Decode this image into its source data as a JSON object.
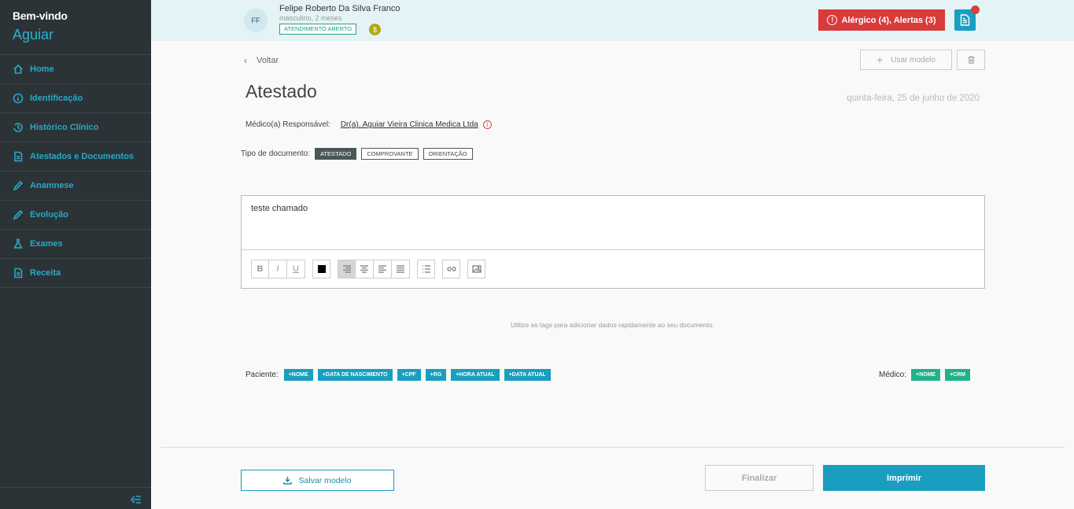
{
  "sidebar": {
    "welcome": "Bem-vindo",
    "user": "Aguiar",
    "items": [
      {
        "label": "Home",
        "icon": "home-icon"
      },
      {
        "label": "Identificação",
        "icon": "info-icon"
      },
      {
        "label": "Histórico Clínico",
        "icon": "history-icon"
      },
      {
        "label": "Atestados e Documentos",
        "icon": "document-icon"
      },
      {
        "label": "Anamnese",
        "icon": "pencil-icon"
      },
      {
        "label": "Evolução",
        "icon": "pencil-icon"
      },
      {
        "label": "Exames",
        "icon": "flask-icon"
      },
      {
        "label": "Receita",
        "icon": "document-icon"
      }
    ]
  },
  "patient": {
    "initials": "FF",
    "name": "Felipe Roberto Da Silva Franco",
    "info": "masculino, 2 meses",
    "status": "ATENDIMENTO ABERTO",
    "badge": "$"
  },
  "header": {
    "alert_icon": "!",
    "alert_label": "Alérgico (4),  Alertas (3)"
  },
  "page": {
    "back": "Voltar",
    "use_model": "Usar modelo",
    "title": "Atestado",
    "date": "quinta-feira, 25 de junho de 2020",
    "resp_label": "Médico(a) Responsável:",
    "resp_value": "Dr(a). Aguiar Vieira Clinica Medica Ltda",
    "resp_info": "i",
    "doc_type_label": "Tipo de documento:",
    "doc_types": [
      "ATESTADO",
      "COMPROVANTE",
      "ORIENTAÇÃO"
    ],
    "editor_text": "teste chamado",
    "hint": "Utilize as tags para adicionar dados rapidamente ao seu documento.",
    "patient_label": "Paciente:",
    "patient_tags": [
      "+NOME",
      "+DATA DE NASCIMENTO",
      "+CPF",
      "+RG",
      "+HORA ATUAL",
      "+DATA ATUAL"
    ],
    "doctor_label": "Médico:",
    "doctor_tags": [
      "+NOME",
      "+CRM"
    ],
    "save_model": "Salvar modelo",
    "finalize": "Finalizar",
    "print": "Imprimir"
  },
  "toolbar": {
    "bold": "B",
    "italic": "I",
    "underline": "U"
  },
  "colors": {
    "sidebar": "#2c3336",
    "accent": "#1a9ec0",
    "alert": "#d93a3a",
    "green": "#21b18b"
  }
}
